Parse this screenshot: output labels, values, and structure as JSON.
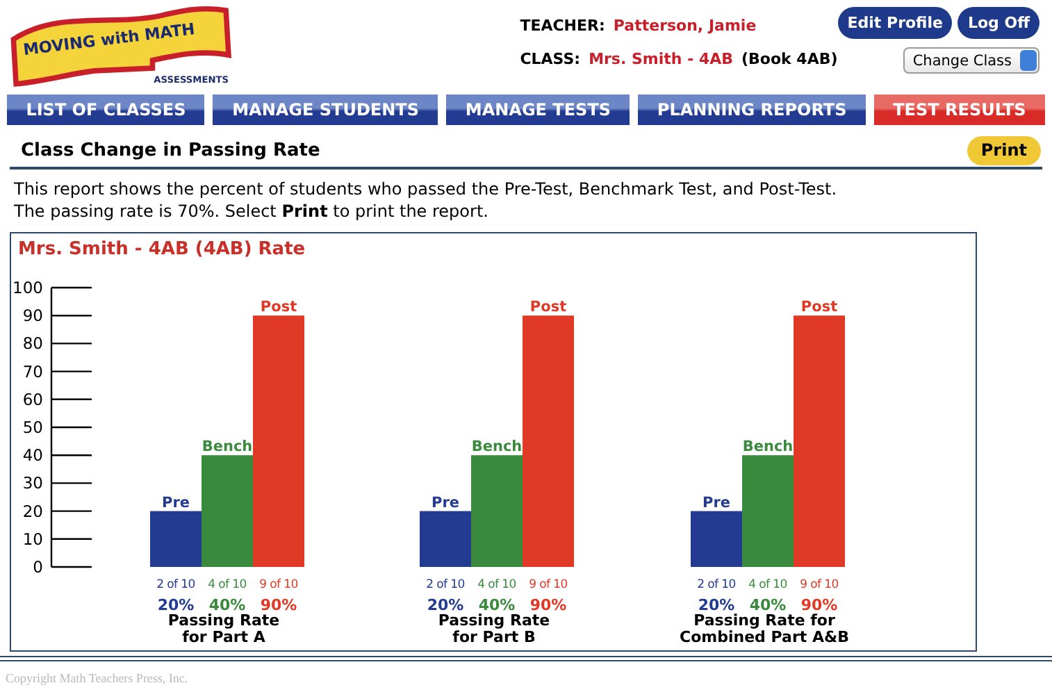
{
  "header": {
    "logo": {
      "title": "MOVING with MATH",
      "subtitle": "ASSESSMENTS"
    },
    "teacher_label": "TEACHER:",
    "teacher": "Patterson, Jamie",
    "class_label": "CLASS:",
    "class_name": "Mrs. Smith - 4AB",
    "book": "(Book 4AB)",
    "buttons": [
      "Edit Profile",
      "Log Off"
    ],
    "class_select": "Change Class"
  },
  "tabs": [
    {
      "label": "LIST OF CLASSES",
      "selected": false
    },
    {
      "label": "MANAGE STUDENTS",
      "selected": false
    },
    {
      "label": "MANAGE TESTS",
      "selected": false
    },
    {
      "label": "PLANNING REPORTS",
      "selected": false
    },
    {
      "label": "TEST RESULTS",
      "selected": true
    }
  ],
  "page_title": "Class Change in Passing Rate",
  "print_button": "Print",
  "description": [
    "This report shows the percent of students who passed the Pre-Test, Benchmark Test, and Post-Test.",
    "The passing rate is 70%. Select **Print** to print the report."
  ],
  "report": {
    "title": "Mrs. Smith - 4AB (4AB) Rate",
    "chart_data": {
      "type": "bar",
      "categories": [
        "Passing Rate\nfor Part A",
        "Passing Rate\nfor Part B",
        "Passing Rate for\nCombined Part A&B"
      ],
      "series": [
        {
          "name": "Pre",
          "color": "#233c91",
          "values": [
            20,
            20,
            20
          ]
        },
        {
          "name": "Bench",
          "color": "#3a8a3e",
          "values": [
            40,
            40,
            40
          ]
        },
        {
          "name": "Post",
          "color": "#e03a26",
          "values": [
            90,
            90,
            90
          ]
        }
      ],
      "ylim": [
        0,
        100
      ],
      "yticks": [
        0,
        10,
        20,
        30,
        40,
        50,
        60,
        70,
        80,
        90,
        100
      ]
    },
    "groups": [
      {
        "counts": [
          "2 of 10",
          "4 of 10",
          "9 of 10"
        ],
        "percents": [
          "20%",
          "40%",
          "90%"
        ]
      },
      {
        "counts": [
          "2 of 10",
          "4 of 10",
          "9 of 10"
        ],
        "percents": [
          "20%",
          "40%",
          "90%"
        ]
      },
      {
        "counts": [
          "2 of 10",
          "4 of 10",
          "9 of 10"
        ],
        "percents": [
          "20%",
          "40%",
          "90%"
        ]
      }
    ]
  },
  "copyright": "Copyright Math Teachers Press, Inc."
}
